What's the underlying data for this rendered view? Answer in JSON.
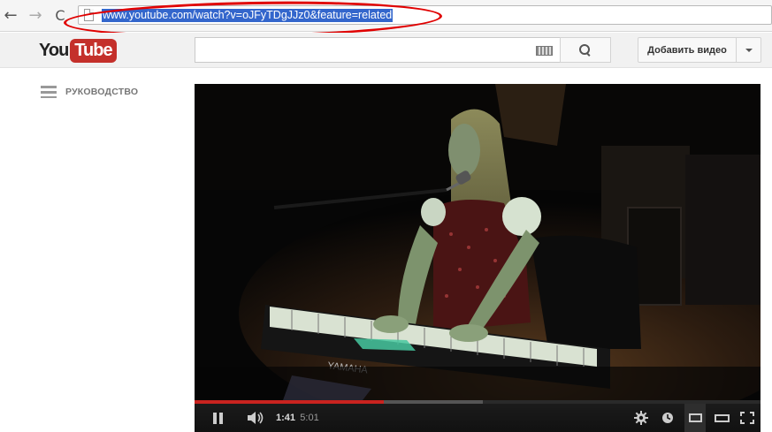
{
  "browser": {
    "back_glyph": "←",
    "forward_glyph": "→",
    "reload_glyph": "C",
    "url": "www.youtube.com/watch?v=oJFyTDgJJz0&feature=related",
    "icons": [
      "back-arrow-icon",
      "forward-arrow-icon",
      "reload-icon",
      "page-icon"
    ]
  },
  "header": {
    "logo_you": "You",
    "logo_tube": "Tube",
    "search_placeholder": "",
    "upload_label": "Добавить видео",
    "brand_color": "#c4302b"
  },
  "sidebar": {
    "guide_label": "РУКОВОДСТВО"
  },
  "player": {
    "current_time": "1:41",
    "duration": "5:01",
    "played_fraction": 0.335,
    "loaded_fraction": 0.51,
    "state": "playing",
    "progress_color": "#c9231f",
    "icons": [
      "pause-icon",
      "volume-icon",
      "settings-icon",
      "watch-later-icon",
      "small-player-icon",
      "large-player-icon",
      "fullscreen-icon"
    ]
  },
  "annotation": {
    "color": "#e00000"
  }
}
